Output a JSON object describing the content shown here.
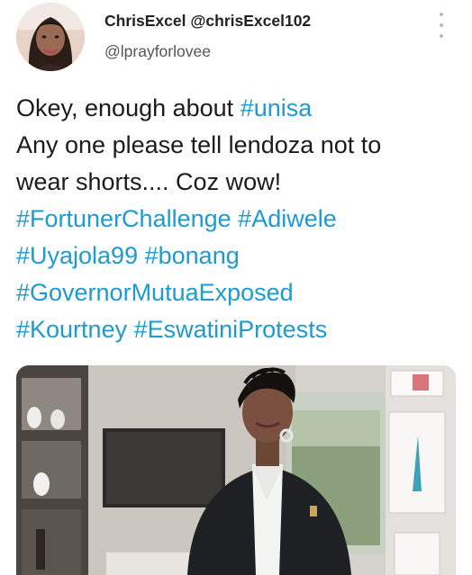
{
  "tweet": {
    "display_name": "ChrisExcel",
    "handle": "@chrisExcel102",
    "reply_to": "@lprayforlovee",
    "lines": [
      [
        "Okey, enough about ",
        "#unisa"
      ],
      [
        "Any one please tell lendoza not to"
      ],
      [
        "wear shorts.... Coz wow!"
      ],
      [
        "#FortunerChallenge",
        " ",
        "#Adiwele"
      ],
      [
        "#Uyajola99",
        " ",
        "#bonang"
      ],
      [
        "#GovernorMutuaExposed"
      ],
      [
        "#Kourtney",
        " ",
        "#EswatiniProtests"
      ]
    ]
  },
  "icons": {
    "more": "more-vertical-icon"
  },
  "colors": {
    "hashtag": "#1d9bd1",
    "text": "#1b1b1b",
    "handle": "#555555"
  }
}
